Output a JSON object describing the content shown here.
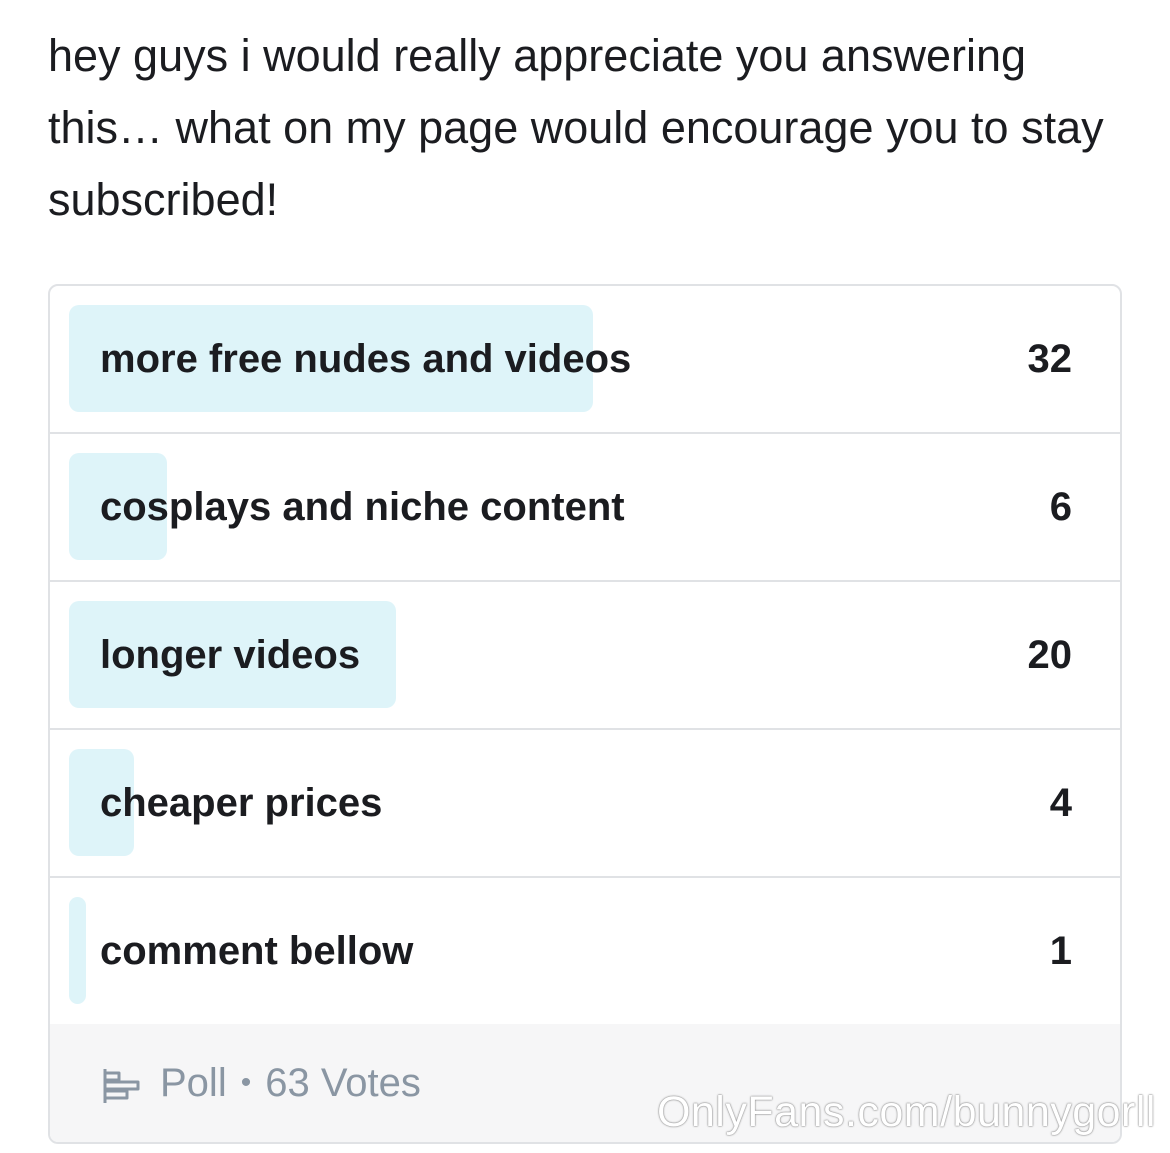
{
  "post": {
    "text": "hey guys i would really appreciate you answering this… what on my page would encourage you to stay subscribed!"
  },
  "poll": {
    "options": [
      {
        "label": "more free nudes and videos",
        "votes": "32",
        "fraction": 0.508
      },
      {
        "label": "cosplays and niche content",
        "votes": "6",
        "fraction": 0.095
      },
      {
        "label": "longer videos",
        "votes": "20",
        "fraction": 0.317
      },
      {
        "label": "cheaper prices",
        "votes": "4",
        "fraction": 0.063
      },
      {
        "label": "comment bellow",
        "votes": "1",
        "fraction": 0.016
      }
    ],
    "footer": {
      "icon": "poll-icon",
      "type_label": "Poll",
      "separator": "•",
      "votes_label": "63 Votes"
    },
    "colors": {
      "bar": "#def4f9",
      "footer_text": "#8a96a3"
    }
  },
  "watermark": {
    "text": "OnlyFans.com/bunnygorll"
  }
}
